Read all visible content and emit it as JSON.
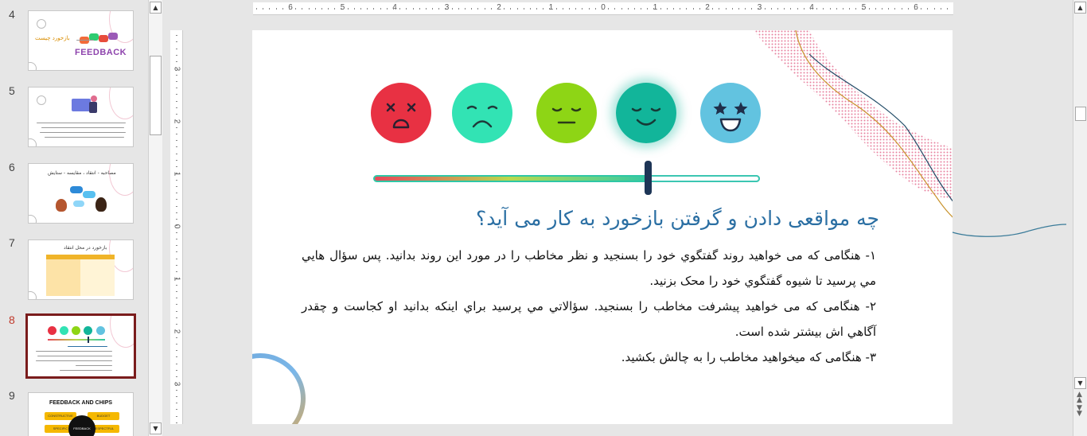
{
  "thumbnails": [
    {
      "num": "4",
      "title": "بازخورد چیست",
      "caption": "FEEDBACK"
    },
    {
      "num": "5",
      "title": ""
    },
    {
      "num": "6",
      "title": "مصاحبه - انتقاد ، مقایسه - ستایش"
    },
    {
      "num": "7",
      "title": "بازخورد در محل انتقاد"
    },
    {
      "num": "8",
      "title": ""
    },
    {
      "num": "9",
      "title": "FEEDBACK AND CHIPS",
      "center_label": "FEEDBACK",
      "tags": [
        "CONSTRUCTIVE",
        "BUDGET",
        "SPECIFIC",
        "RESPECTFUL"
      ]
    }
  ],
  "ruler": {
    "horizontal": [
      "6",
      "5",
      "4",
      "3",
      "2",
      "1",
      "0",
      "1",
      "2",
      "3",
      "4",
      "5",
      "6"
    ],
    "vertical": [
      "3",
      "2",
      "1",
      "0",
      "1",
      "2",
      "3"
    ]
  },
  "slide": {
    "title": "چه مواقعی دادن و گرفتن بازخورد به کار می آید؟",
    "paragraphs": [
      "۱- هنگامی که می خواهید روند گفتگوي خود را بسنجید و نظر مخاطب را در مورد اين روند بدانيد. پس سؤال هايي مي پرسيد تا شيوه گفتگوي خود را محک بزنيد.",
      "۲- هنگامی که می خواهید پیشرفت مخاطب را بسنجید. سؤالاتي مي پرسيد براي اينكه بدانيد او كجاست و چقدر آگاهي اش بيشتر شده است.",
      "۳- هنگامی که میخواهید مخاطب را به چالش بکشید."
    ],
    "faces": [
      {
        "name": "angry-face-icon",
        "color": "#e83143"
      },
      {
        "name": "sad-face-icon",
        "color": "#32e3b4"
      },
      {
        "name": "neutral-face-icon",
        "color": "#8ed515"
      },
      {
        "name": "smiling-face-icon",
        "color": "#12b59a"
      },
      {
        "name": "star-eyes-face-icon",
        "color": "#62c3e0"
      }
    ],
    "slider_value": 0.71
  },
  "colors": {
    "active_thumb_border": "#7a1c1c",
    "title_blue": "#2b6fa3",
    "active_num": "#c0392b"
  }
}
